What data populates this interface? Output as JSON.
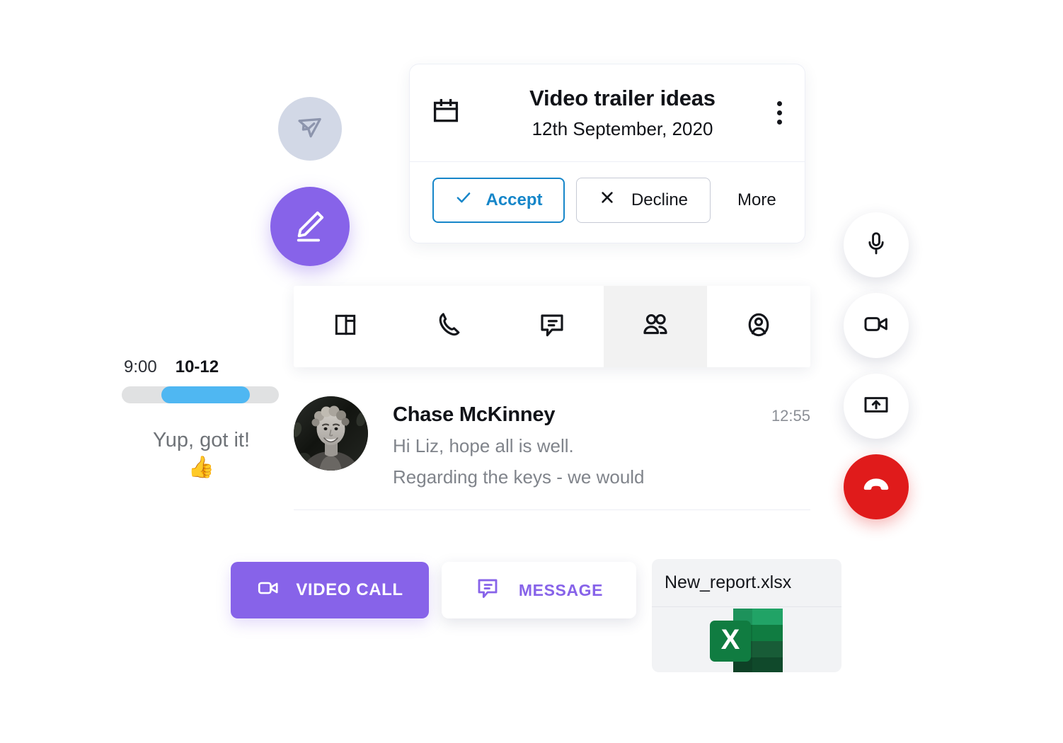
{
  "floating_actions": {
    "send": {
      "icon": "send-plane-icon",
      "state": "disabled"
    },
    "edit": {
      "icon": "pencil-icon",
      "state": "active",
      "color": "#8763e9"
    }
  },
  "invite_card": {
    "icon": "calendar-icon",
    "title": "Video trailer ideas",
    "date": "12th September, 2020",
    "menu_icon": "kebab-menu-icon",
    "accept_label": "Accept",
    "accept_icon": "check-icon",
    "accept_color": "#1686c9",
    "decline_label": "Decline",
    "decline_icon": "close-x-icon",
    "more_label": "More"
  },
  "tabbar": {
    "items": [
      {
        "icon": "layout-panel-icon",
        "label": "Layout",
        "active": false
      },
      {
        "icon": "phone-icon",
        "label": "Call",
        "active": false
      },
      {
        "icon": "chat-bubble-icon",
        "label": "Chat",
        "active": false
      },
      {
        "icon": "people-icon",
        "label": "Participants",
        "active": true
      },
      {
        "icon": "person-circle-icon",
        "label": "Profile",
        "active": false
      }
    ],
    "active_background": "#f2f2f2"
  },
  "time_slider": {
    "start_label": "9:00",
    "range_label": "10-12",
    "track_color": "#e0e1e2",
    "fill_color": "#4fb7f2",
    "fill_start_percent": 25,
    "fill_width_percent": 56
  },
  "reply_note": {
    "text": "Yup, got it!",
    "emoji": "👍"
  },
  "message": {
    "avatar": "user-avatar",
    "name": "Chase McKinney",
    "time": "12:55",
    "lines": [
      "Hi Liz, hope all is well.",
      "Regarding the keys - we would"
    ]
  },
  "cta": {
    "video_call_label": "VIDEO CALL",
    "video_call_icon": "video-camera-icon",
    "video_call_color": "#8763e9",
    "message_label": "MESSAGE",
    "message_icon": "chat-bubble-icon",
    "message_color": "#8763e9"
  },
  "file_attachment": {
    "name": "New_report.xlsx",
    "icon": "excel-file-icon",
    "icon_letter": "X",
    "icon_color": "#1d7044"
  },
  "call_controls": [
    {
      "icon": "microphone-icon",
      "label": "Mute",
      "color": "#ffffff"
    },
    {
      "icon": "video-camera-icon",
      "label": "Camera",
      "color": "#ffffff"
    },
    {
      "icon": "screen-share-icon",
      "label": "Share screen",
      "color": "#ffffff"
    },
    {
      "icon": "hang-up-icon",
      "label": "End call",
      "color": "#e01b1b"
    }
  ]
}
